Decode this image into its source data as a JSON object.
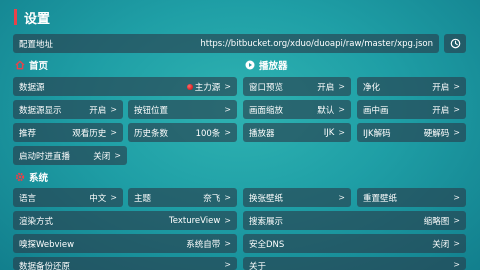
{
  "page": {
    "title": "设置"
  },
  "config": {
    "label": "配置地址",
    "url": "https://bitbucket.org/xduo/duoapi/raw/master/xpg.json"
  },
  "sections": {
    "home": "首页",
    "player": "播放器",
    "system": "系统"
  },
  "home": {
    "source": {
      "label": "数据源",
      "value": "主力源"
    },
    "source_display": {
      "label": "数据源显示",
      "value": "开启"
    },
    "button_position": {
      "label": "按钮位置"
    },
    "recommend": {
      "label": "推荐",
      "value": "观看历史"
    },
    "history_count": {
      "label": "历史条数",
      "value": "100条"
    },
    "startup_live": {
      "label": "启动时进直播",
      "value": "关闭"
    }
  },
  "player": {
    "window_preview": {
      "label": "窗口预览",
      "value": "开启"
    },
    "purify": {
      "label": "净化",
      "value": "开启"
    },
    "scale": {
      "label": "画面缩放",
      "value": "默认"
    },
    "pip": {
      "label": "画中画",
      "value": "开启"
    },
    "player": {
      "label": "播放器",
      "value": "IJK"
    },
    "ijk_decode": {
      "label": "IJK解码",
      "value": "硬解码"
    }
  },
  "system": {
    "language": {
      "label": "语言",
      "value": "中文"
    },
    "theme": {
      "label": "主题",
      "value": "奈飞"
    },
    "change_wallpaper": {
      "label": "换张壁纸"
    },
    "reset_wallpaper": {
      "label": "重置壁纸"
    },
    "render": {
      "label": "渲染方式",
      "value": "TextureView"
    },
    "search_display": {
      "label": "搜索展示",
      "value": "缩略图"
    },
    "sniff_webview": {
      "label": "嗅探Webview",
      "value": "系统自带"
    },
    "secure_dns": {
      "label": "安全DNS",
      "value": "关闭"
    },
    "backup": {
      "label": "数据备份还原"
    },
    "about": {
      "label": "关于"
    }
  },
  "glyphs": {
    "arrow": ">"
  },
  "icons": {
    "home": "home-icon",
    "player": "play-circle-icon",
    "system": "gear-icon",
    "history": "history-icon"
  },
  "colors": {
    "accent": "#e8424a",
    "button_bg": "rgba(40,60,75,0.62)",
    "bg_center": "#2fb3b2"
  }
}
